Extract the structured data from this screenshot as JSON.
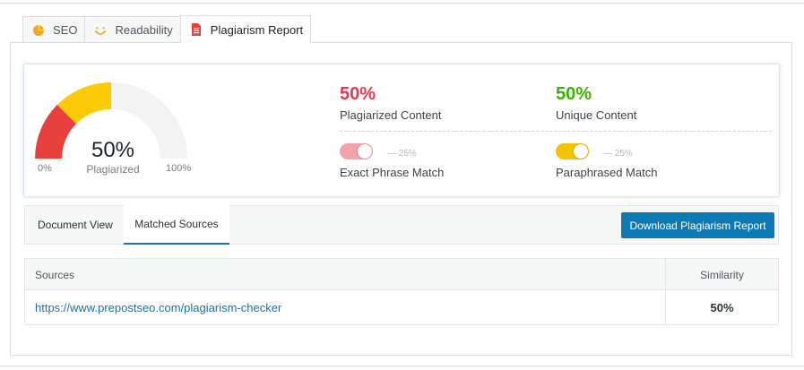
{
  "tabs": [
    {
      "label": "SEO",
      "icon": "pie-chart-icon"
    },
    {
      "label": "Readability",
      "icon": "smile-icon"
    },
    {
      "label": "Plagiarism Report",
      "icon": "document-icon"
    }
  ],
  "gauge": {
    "percent": "50%",
    "label": "Plagiarized",
    "min": "0%",
    "max": "100%",
    "value": 0.5,
    "colors": {
      "red": "#e8413d",
      "yellow": "#fdcb05",
      "track": "#f3f3f3"
    }
  },
  "stats": {
    "plagiarized": {
      "value": "50%",
      "label": "Plagiarized Content",
      "color": "#e8384f"
    },
    "unique": {
      "value": "50%",
      "label": "Unique Content",
      "color": "#3bb300"
    }
  },
  "toggles": {
    "exact": {
      "label": "Exact Phrase Match",
      "note": "— 25%",
      "on": true,
      "color": "#f3a3a7"
    },
    "paraphrased": {
      "label": "Paraphrased Match",
      "note": "— 25%",
      "on": true,
      "color": "#f5c400"
    }
  },
  "subtabs": {
    "document_view": "Document View",
    "matched_sources": "Matched Sources"
  },
  "download_label": "Download Plagiarism Report",
  "table": {
    "headers": {
      "sources": "Sources",
      "similarity": "Similarity"
    },
    "rows": [
      {
        "url": "https://www.prepostseo.com/plagiarism-checker",
        "similarity": "50%"
      }
    ]
  }
}
